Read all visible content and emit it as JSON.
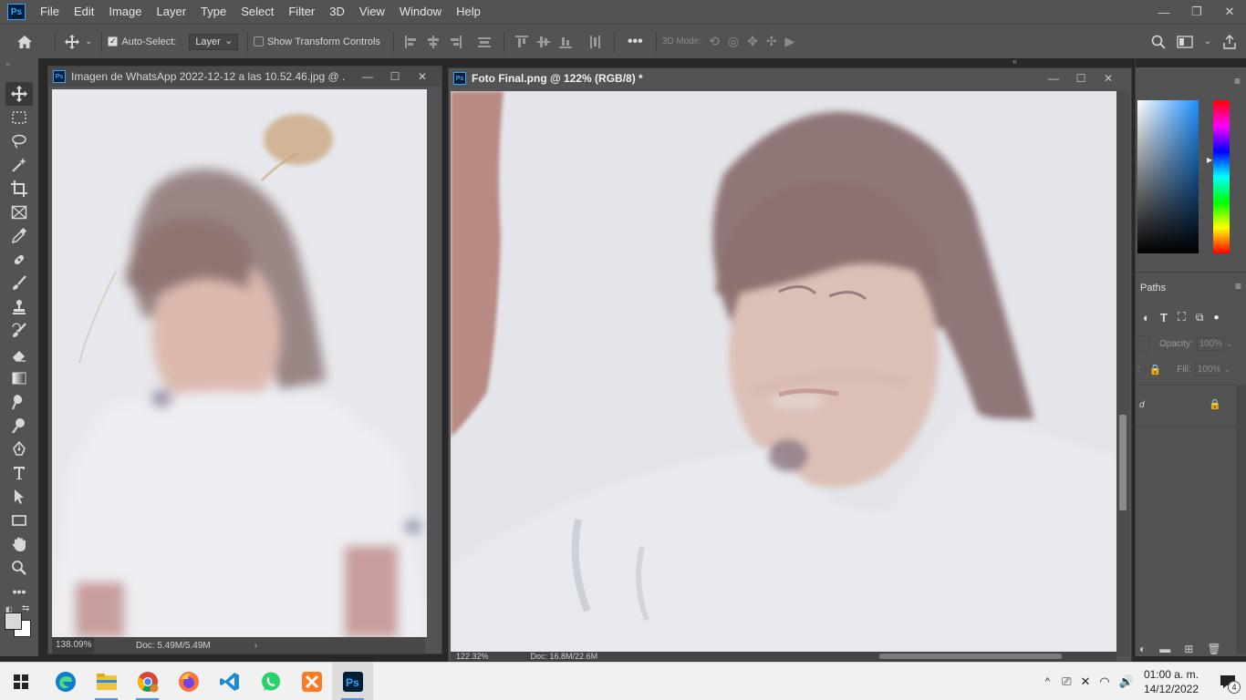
{
  "menubar": {
    "app_logo": "Ps",
    "items": [
      "File",
      "Edit",
      "Image",
      "Layer",
      "Type",
      "Select",
      "Filter",
      "3D",
      "View",
      "Window",
      "Help"
    ]
  },
  "options_bar": {
    "auto_select_label": "Auto-Select:",
    "auto_select_checked": true,
    "auto_select_target": "Layer",
    "transform_controls_label": "Show Transform Controls",
    "transform_controls_checked": false,
    "three_d_mode_label": "3D Mode:"
  },
  "documents": [
    {
      "title": "Imagen de WhatsApp 2022-12-12 a las 10.52.46.jpg @ ...",
      "zoom": "138.09%",
      "doc_size": "Doc: 5.49M/5.49M",
      "active": false
    },
    {
      "title": "Foto Final.png @ 122% (RGB/8) *",
      "zoom": "122.32%",
      "doc_size": "Doc: 16.8M/22.6M",
      "active": true
    }
  ],
  "right_panel": {
    "paths_tab": "Paths",
    "opacity_label": "Opacity:",
    "opacity_value": "100%",
    "fill_label": "Fill:",
    "fill_value": "100%"
  },
  "taskbar": {
    "apps": [
      "edge-icon",
      "file-explorer-icon",
      "chrome-icon",
      "firefox-icon",
      "vscode-icon",
      "whatsapp-icon",
      "xampp-icon",
      "photoshop-icon"
    ],
    "time": "01:00 a. m.",
    "date": "14/12/2022",
    "notification_count": "4"
  },
  "colors": {
    "ui_dark": "#535353",
    "ps_blue": "#31a8ff",
    "foreground_swatch": "#d9d9d9",
    "background_swatch": "#ffffff"
  }
}
